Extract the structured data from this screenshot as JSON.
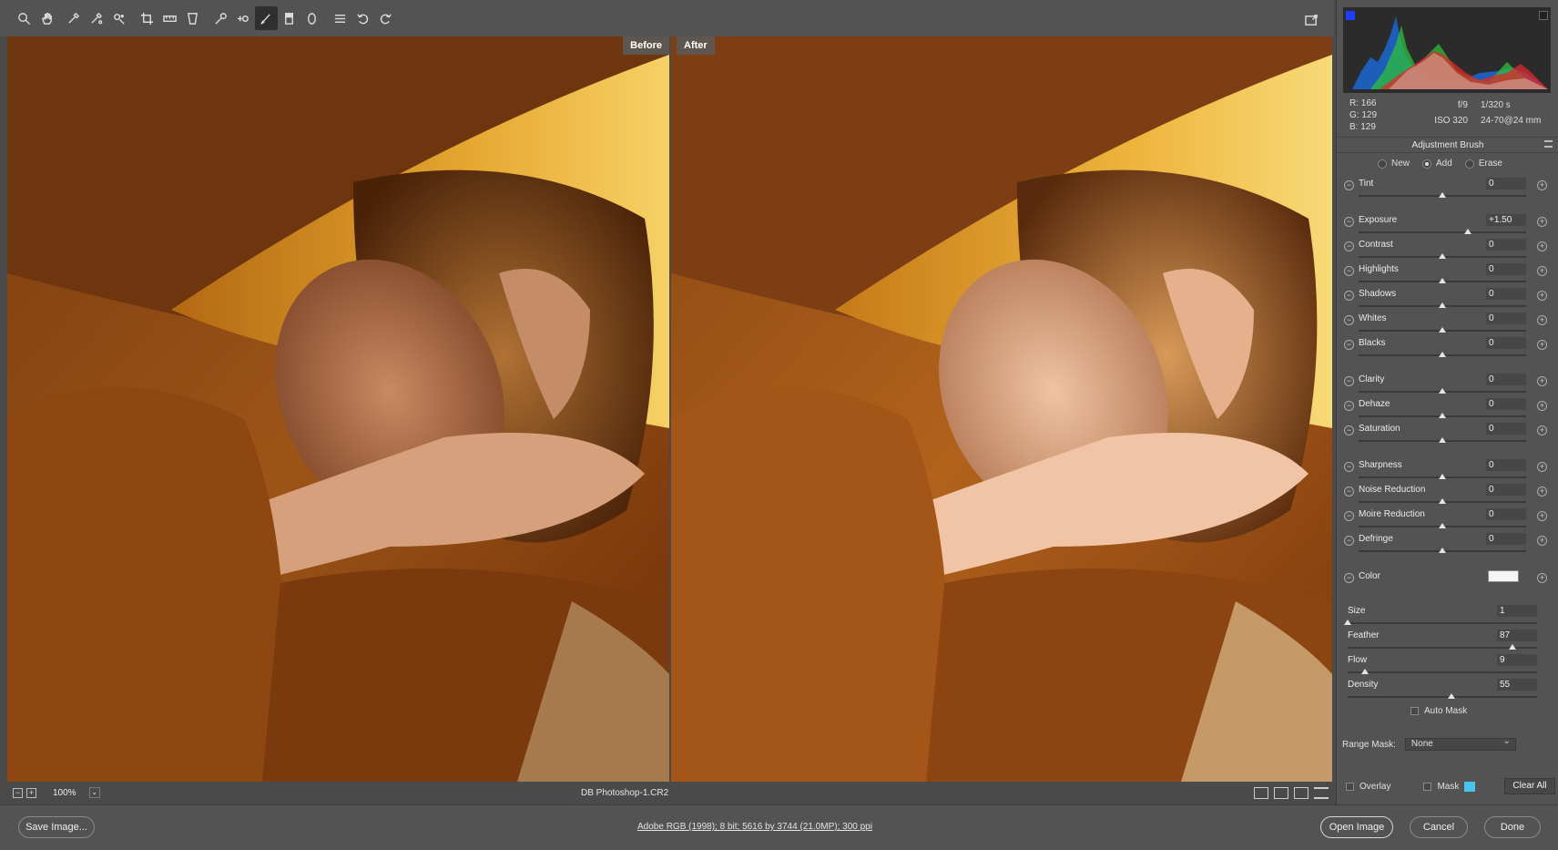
{
  "toolbar": {
    "tools": [
      "zoom-icon",
      "hand-icon",
      "white-balance-icon",
      "color-sampler-icon",
      "targeted-adjustment-icon",
      "crop-icon",
      "straighten-icon",
      "transform-icon",
      "spot-removal-icon",
      "red-eye-icon",
      "adjustment-brush-icon",
      "graduated-filter-icon",
      "radial-filter-icon",
      "preferences-icon",
      "rotate-left-icon",
      "rotate-right-icon"
    ],
    "active_tool": "adjustment-brush-icon"
  },
  "canvas": {
    "before_label": "Before",
    "after_label": "After",
    "zoom": "100%",
    "filename": "DB Photoshop-1.CR2"
  },
  "readouts": {
    "r": "R:  166",
    "g": "G:  129",
    "b": "B:  129",
    "aperture": "f/9",
    "shutter": "1/320 s",
    "iso": "ISO 320",
    "lens": "24-70@24 mm"
  },
  "panel": {
    "title": "Adjustment Brush",
    "modes": [
      "New",
      "Add",
      "Erase"
    ],
    "selected_mode": "Add",
    "sliders": [
      {
        "label": "Tint",
        "value": "0",
        "pos": 0.5
      },
      {
        "label": "Exposure",
        "value": "+1.50",
        "pos": 0.65
      },
      {
        "label": "Contrast",
        "value": "0",
        "pos": 0.5
      },
      {
        "label": "Highlights",
        "value": "0",
        "pos": 0.5
      },
      {
        "label": "Shadows",
        "value": "0",
        "pos": 0.5
      },
      {
        "label": "Whites",
        "value": "0",
        "pos": 0.5
      },
      {
        "label": "Blacks",
        "value": "0",
        "pos": 0.5
      },
      {
        "label": "Clarity",
        "value": "0",
        "pos": 0.5
      },
      {
        "label": "Dehaze",
        "value": "0",
        "pos": 0.5
      },
      {
        "label": "Saturation",
        "value": "0",
        "pos": 0.5
      },
      {
        "label": "Sharpness",
        "value": "0",
        "pos": 0.5
      },
      {
        "label": "Noise Reduction",
        "value": "0",
        "pos": 0.5
      },
      {
        "label": "Moire Reduction",
        "value": "0",
        "pos": 0.5
      },
      {
        "label": "Defringe",
        "value": "0",
        "pos": 0.5
      }
    ],
    "color_label": "Color",
    "brush": [
      {
        "label": "Size",
        "value": "1",
        "pos": 0.0
      },
      {
        "label": "Feather",
        "value": "87",
        "pos": 0.87
      },
      {
        "label": "Flow",
        "value": "9",
        "pos": 0.09
      },
      {
        "label": "Density",
        "value": "55",
        "pos": 0.55
      }
    ],
    "auto_mask": "Auto Mask",
    "range_mask_label": "Range Mask:",
    "range_mask_value": "None",
    "overlay": "Overlay",
    "mask": "Mask",
    "clear_all": "Clear All",
    "mask_color": "#49c4ef"
  },
  "bottom": {
    "save": "Save Image...",
    "workflow": "Adobe RGB (1998); 8 bit; 5616 by 3744 (21.0MP); 300 ppi",
    "open": "Open Image",
    "cancel": "Cancel",
    "done": "Done"
  }
}
